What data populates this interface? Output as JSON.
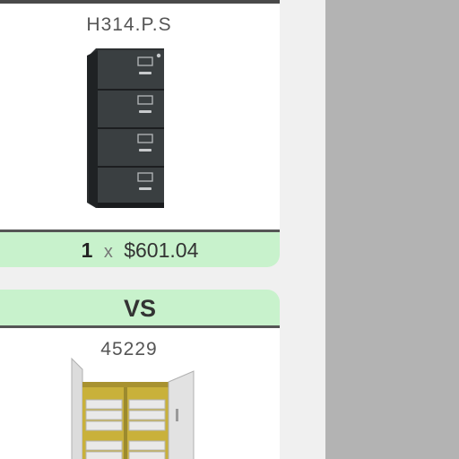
{
  "products": [
    {
      "sku": "H314.P.S",
      "image_icon": "filing-cabinet-icon",
      "quantity": "1",
      "times": "x",
      "price": "$601.04"
    },
    {
      "sku": "45229",
      "image_icon": "storage-cabinet-icon"
    }
  ],
  "compare": {
    "vs_label": "VS"
  },
  "colors": {
    "price_bar_bg": "#c8f2cc",
    "side_panel": "#b3b3b3",
    "divider": "#555555"
  }
}
